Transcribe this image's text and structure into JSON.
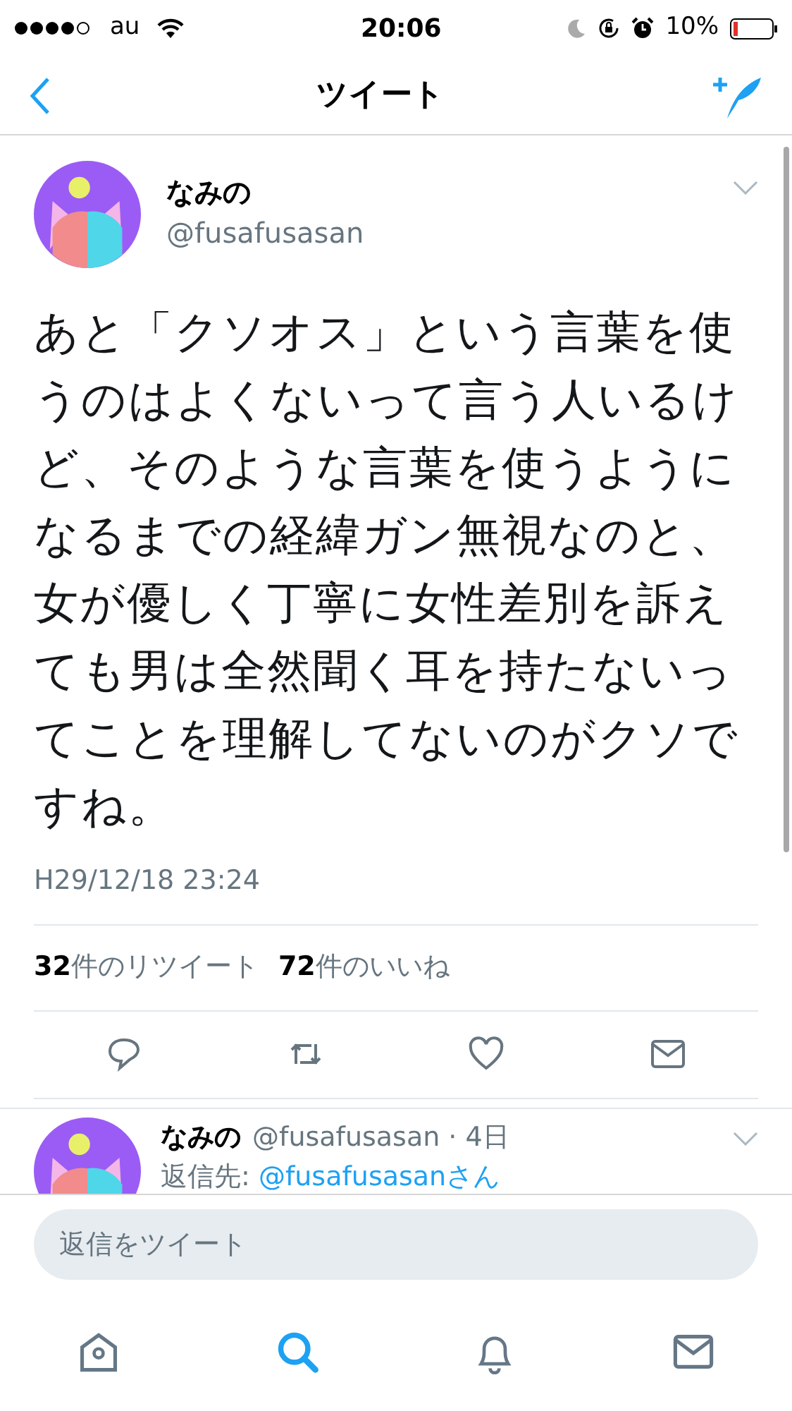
{
  "status_bar": {
    "carrier": "au",
    "time": "20:06",
    "battery": "10%"
  },
  "nav": {
    "title": "ツイート"
  },
  "tweet": {
    "name": "なみの",
    "handle": "@fusafusasan",
    "text": "あと「クソオス」という言葉を使うのはよくないって言う人いるけど、そのような言葉を使うようになるまでの経緯ガン無視なのと、女が優しく丁寧に女性差別を訴えても男は全然聞く耳を持たないってことを理解してないのがクソですね。",
    "timestamp": "H29/12/18 23:24",
    "stats": [
      {
        "count": "32",
        "label": "件のリツイート"
      },
      {
        "count": "72",
        "label": "件のいいね"
      }
    ]
  },
  "reply": {
    "name": "なみの",
    "meta": "@fusafusasan · 4日",
    "reply_label": "返信先: ",
    "reply_user": "@fusafusasanさん"
  },
  "reply_field": {
    "placeholder": "返信をツイート"
  },
  "tab_bar": [
    {
      "kind": "home",
      "selected": false
    },
    {
      "kind": "search",
      "selected": true
    },
    {
      "kind": "notifications",
      "selected": false
    },
    {
      "kind": "messages",
      "selected": false
    }
  ]
}
